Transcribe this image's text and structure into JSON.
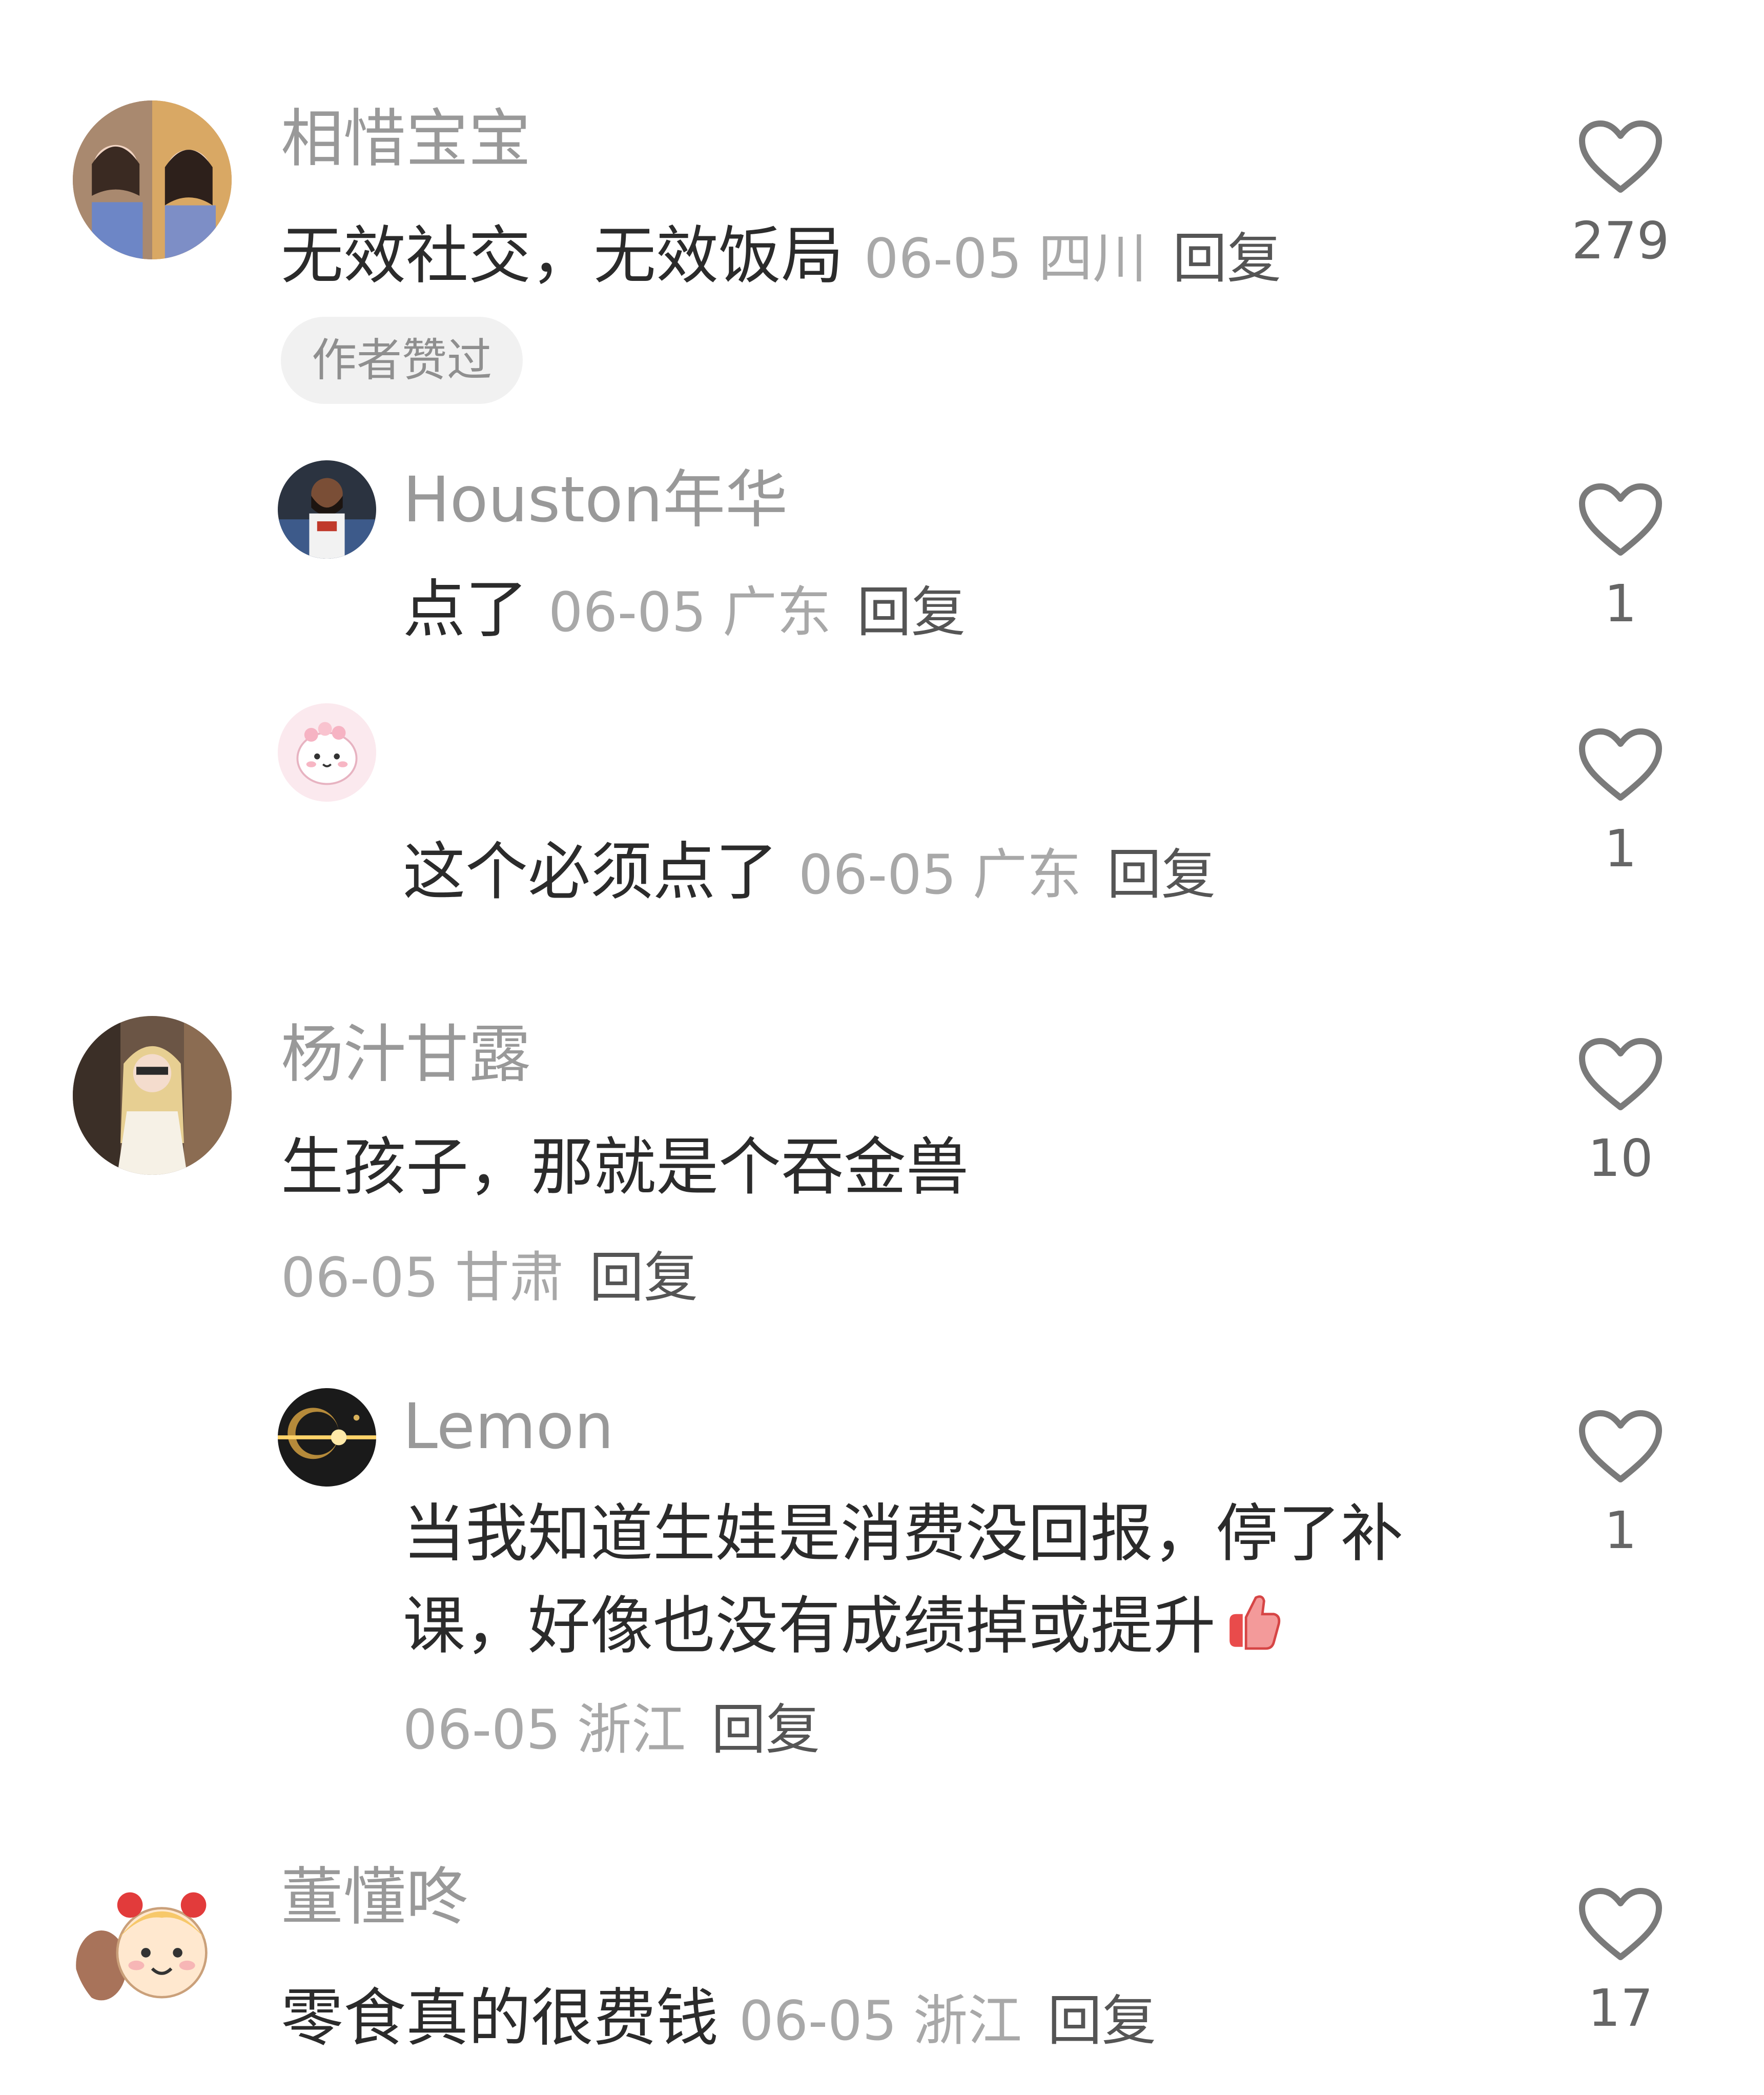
{
  "comments": [
    {
      "username": "相惜宝宝",
      "text": "无效社交，无效饭局",
      "date": "06-05",
      "location": "四川",
      "reply_label": "回复",
      "badge": "作者赞过",
      "likes": "279",
      "avatar_icon": "avatar-two-women-photo"
    },
    {
      "username": "Houston年华",
      "text": "点了",
      "date": "06-05",
      "location": "广东",
      "reply_label": "回复",
      "likes": "1",
      "avatar_icon": "avatar-basketball-player-photo"
    },
    {
      "username": "",
      "text": "这个必须点了",
      "date": "06-05",
      "location": "广东",
      "reply_label": "回复",
      "likes": "1",
      "avatar_icon": "avatar-pink-cartoon"
    },
    {
      "username": "杨汁甘露",
      "text": "生孩子，那就是个吞金兽",
      "date": "06-05",
      "location": "甘肃",
      "reply_label": "回复",
      "likes": "10",
      "avatar_icon": "avatar-blonde-woman-photo"
    },
    {
      "username": "Lemon",
      "text_line1": "当我知道生娃是消费没回报，停了补",
      "text_line2": "课，好像也没有成绩掉或提升",
      "emoji": "thumbs-up-emoji",
      "date": "06-05",
      "location": "浙江",
      "reply_label": "回复",
      "likes": "1",
      "avatar_icon": "avatar-golden-light-photo"
    },
    {
      "username": "董懂咚",
      "text": "零食真的很费钱",
      "date": "06-05",
      "location": "浙江",
      "reply_label": "回复",
      "likes": "17",
      "avatar_icon": "avatar-cartoon-girl-with-dog"
    }
  ],
  "colors": {
    "username": "#999999",
    "text": "#2b2b2b",
    "meta": "#a8a8a8",
    "reply": "#555555",
    "badge_bg": "#f1f1f1",
    "heart": "#7a7a7a"
  }
}
